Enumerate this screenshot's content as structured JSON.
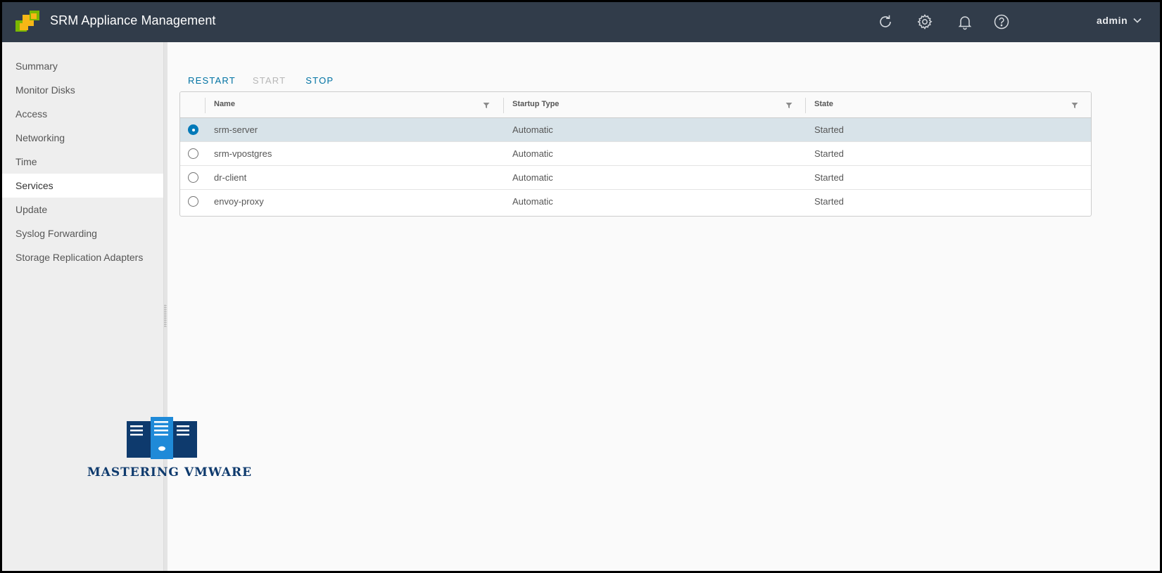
{
  "header": {
    "title": "SRM Appliance Management",
    "icons": [
      "refresh-icon",
      "settings-icon",
      "bell-icon",
      "help-icon"
    ],
    "user": "admin",
    "background": "#313c4a"
  },
  "sidebar": {
    "items": [
      {
        "label": "Summary"
      },
      {
        "label": "Monitor Disks"
      },
      {
        "label": "Access"
      },
      {
        "label": "Networking"
      },
      {
        "label": "Time"
      },
      {
        "label": "Services",
        "active": true
      },
      {
        "label": "Update"
      },
      {
        "label": "Syslog Forwarding"
      },
      {
        "label": "Storage Replication Adapters"
      }
    ]
  },
  "toolbar": {
    "restart": "RESTART",
    "start": "START",
    "stop": "STOP"
  },
  "grid": {
    "columns": [
      "Name",
      "Startup Type",
      "State"
    ],
    "rows": [
      {
        "name": "srm-server",
        "startup_type": "Automatic",
        "state": "Started",
        "selected": true
      },
      {
        "name": "srm-vpostgres",
        "startup_type": "Automatic",
        "state": "Started"
      },
      {
        "name": "dr-client",
        "startup_type": "Automatic",
        "state": "Started"
      },
      {
        "name": "envoy-proxy",
        "startup_type": "Automatic",
        "state": "Started"
      }
    ]
  },
  "watermark": {
    "text": "MASTERING VMWARE"
  },
  "colors": {
    "accent": "#0072a3",
    "selected_row": "#d8e3e9",
    "watermark": "#0e3a6d"
  }
}
